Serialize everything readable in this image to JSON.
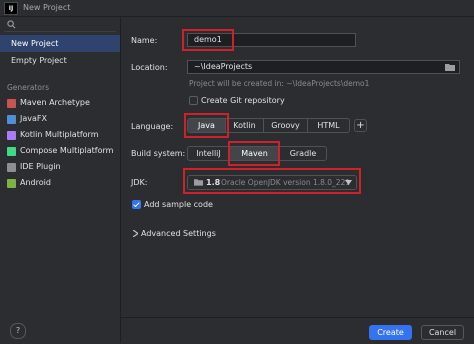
{
  "window": {
    "title": "New Project",
    "app_icon_text": "IJ"
  },
  "sidebar": {
    "search_icon": "search-icon",
    "top_items": [
      {
        "label": "New Project",
        "selected": true
      },
      {
        "label": "Empty Project",
        "selected": false
      }
    ],
    "generators_header": "Generators",
    "generators": [
      {
        "label": "Maven Archetype",
        "icon": "maven-icon",
        "color": "#c75450"
      },
      {
        "label": "JavaFX",
        "icon": "javafx-icon",
        "color": "#4f8fd6"
      },
      {
        "label": "Kotlin Multiplatform",
        "icon": "kotlin-icon",
        "color": "#a97bff"
      },
      {
        "label": "Compose Multiplatform",
        "icon": "compose-icon",
        "color": "#3ddc84"
      },
      {
        "label": "IDE Plugin",
        "icon": "plugin-icon",
        "color": "#8c8f94"
      },
      {
        "label": "Android",
        "icon": "android-icon",
        "color": "#7cb342"
      }
    ],
    "help_label": "?"
  },
  "form": {
    "name_label": "Name:",
    "name_value": "demo1",
    "location_label": "Location:",
    "location_value": "~\\IdeaProjects",
    "location_hint": "Project will be created in: ~\\IdeaProjects\\demo1",
    "git_label": "Create Git repository",
    "git_checked": false,
    "language_label": "Language:",
    "languages": [
      {
        "label": "Java",
        "active": true
      },
      {
        "label": "Kotlin",
        "active": false
      },
      {
        "label": "Groovy",
        "active": false
      },
      {
        "label": "HTML",
        "active": false
      }
    ],
    "add_language_label": "+",
    "build_label": "Build system:",
    "build_systems": [
      {
        "label": "IntelliJ",
        "active": false
      },
      {
        "label": "Maven",
        "active": true
      },
      {
        "label": "Gradle",
        "active": false
      }
    ],
    "jdk_label": "JDK:",
    "jdk_version": "1.8",
    "jdk_name": "Oracle OpenJDK version 1.8.0_221",
    "sample_code_label": "Add sample code",
    "sample_code_checked": true,
    "advanced_label": "Advanced Settings"
  },
  "footer": {
    "create_label": "Create",
    "cancel_label": "Cancel"
  },
  "colors": {
    "accent": "#3574f0",
    "highlight": "#d0202a",
    "selected_nav": "#2e436e"
  }
}
